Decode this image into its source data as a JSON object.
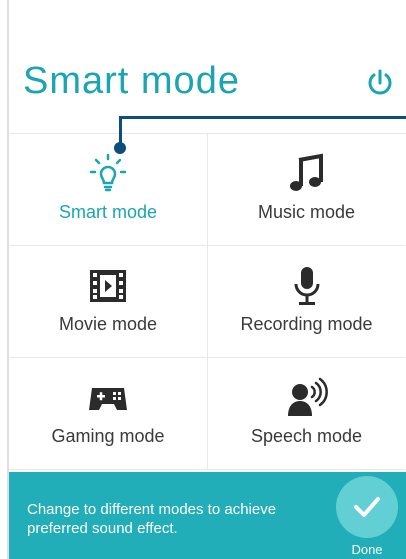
{
  "header": {
    "title": "Smart mode",
    "power_icon": "power-icon"
  },
  "modes": [
    {
      "label": "Smart mode",
      "icon": "lightbulb-icon",
      "active": true
    },
    {
      "label": "Music mode",
      "icon": "music-note-icon",
      "active": false
    },
    {
      "label": "Movie mode",
      "icon": "film-icon",
      "active": false
    },
    {
      "label": "Recording mode",
      "icon": "microphone-icon",
      "active": false
    },
    {
      "label": "Gaming mode",
      "icon": "gamepad-icon",
      "active": false
    },
    {
      "label": "Speech mode",
      "icon": "speaker-person-icon",
      "active": false
    }
  ],
  "footer": {
    "message": "Change to different modes to achieve preferred sound effect.",
    "done_label": "Done"
  },
  "colors": {
    "accent": "#19a5b3",
    "footer_bg": "#21aeb8",
    "callout": "#0d4f7c"
  }
}
